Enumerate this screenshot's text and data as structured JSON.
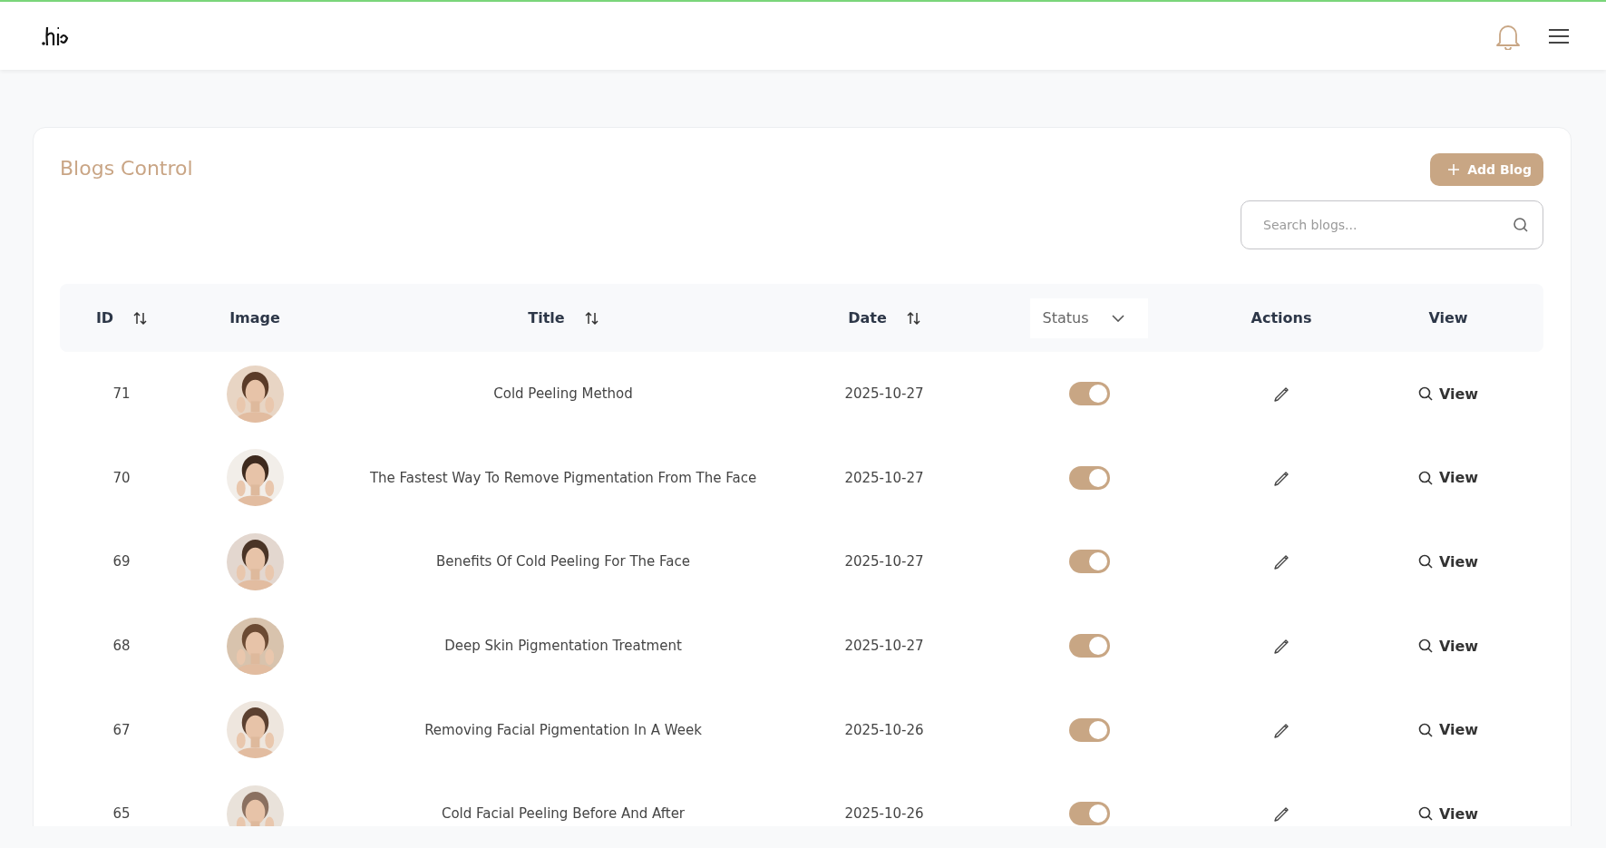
{
  "page": {
    "title": "Blogs Control",
    "add_button": "Add Blog",
    "search": {
      "placeholder": "Search blogs..."
    }
  },
  "table": {
    "columns": [
      {
        "label": "ID",
        "kind": "sort"
      },
      {
        "label": "Image",
        "kind": "plain"
      },
      {
        "label": "Title",
        "kind": "sort"
      },
      {
        "label": "Date",
        "kind": "sort"
      },
      {
        "label": "Status",
        "kind": "dropdown"
      },
      {
        "label": "Actions",
        "kind": "plain"
      },
      {
        "label": "View",
        "kind": "plain"
      }
    ],
    "rows": [
      {
        "id": "71",
        "title": "Cold Peeling Method",
        "date": "2025-10-27",
        "on": true,
        "view": "View"
      },
      {
        "id": "70",
        "title": "The Fastest Way To Remove Pigmentation From The Face",
        "date": "2025-10-27",
        "on": true,
        "view": "View"
      },
      {
        "id": "69",
        "title": "Benefits Of Cold Peeling For The Face",
        "date": "2025-10-27",
        "on": true,
        "view": "View"
      },
      {
        "id": "68",
        "title": "Deep Skin Pigmentation Treatment",
        "date": "2025-10-27",
        "on": true,
        "view": "View"
      },
      {
        "id": "67",
        "title": "Removing Facial Pigmentation In A Week",
        "date": "2025-10-26",
        "on": true,
        "view": "View"
      },
      {
        "id": "65",
        "title": "Cold Facial Peeling Before And After",
        "date": "2025-10-26",
        "on": true,
        "view": "View"
      }
    ]
  }
}
